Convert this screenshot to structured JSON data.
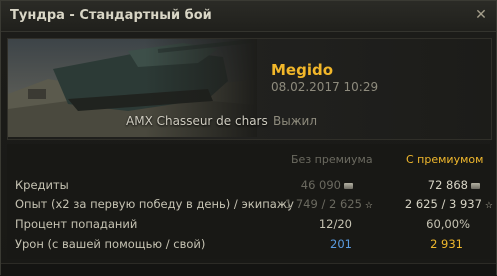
{
  "window": {
    "title": "Тундра - Стандартный бой"
  },
  "battle": {
    "vehicle_name": "AMX Chasseur de chars",
    "status": "Выжил",
    "player": "Megido",
    "datetime": "08.02.2017 10:29"
  },
  "table": {
    "col_basic": "Без премиума",
    "col_premium": "С премиумом",
    "rows": [
      {
        "label": "Кредиты",
        "basic": "46 090",
        "premium": "72 868"
      },
      {
        "label": "Опыт  (x2 за первую победу в день) / экипажу",
        "basic": "1 749 / 2 625",
        "premium": "2 625 / 3 937"
      },
      {
        "label": "Процент попаданий",
        "basic": "12/20",
        "premium": "60,00%"
      },
      {
        "label": "Урон (с вашей помощью / свой)",
        "basic": "201",
        "premium": "2 931"
      }
    ]
  },
  "colors": {
    "accent": "#f0b82d",
    "assist_blue": "#5a9be0",
    "text": "#c6c3b3"
  },
  "icons": [
    "close-icon",
    "credits-icon",
    "experience-star-icon"
  ]
}
